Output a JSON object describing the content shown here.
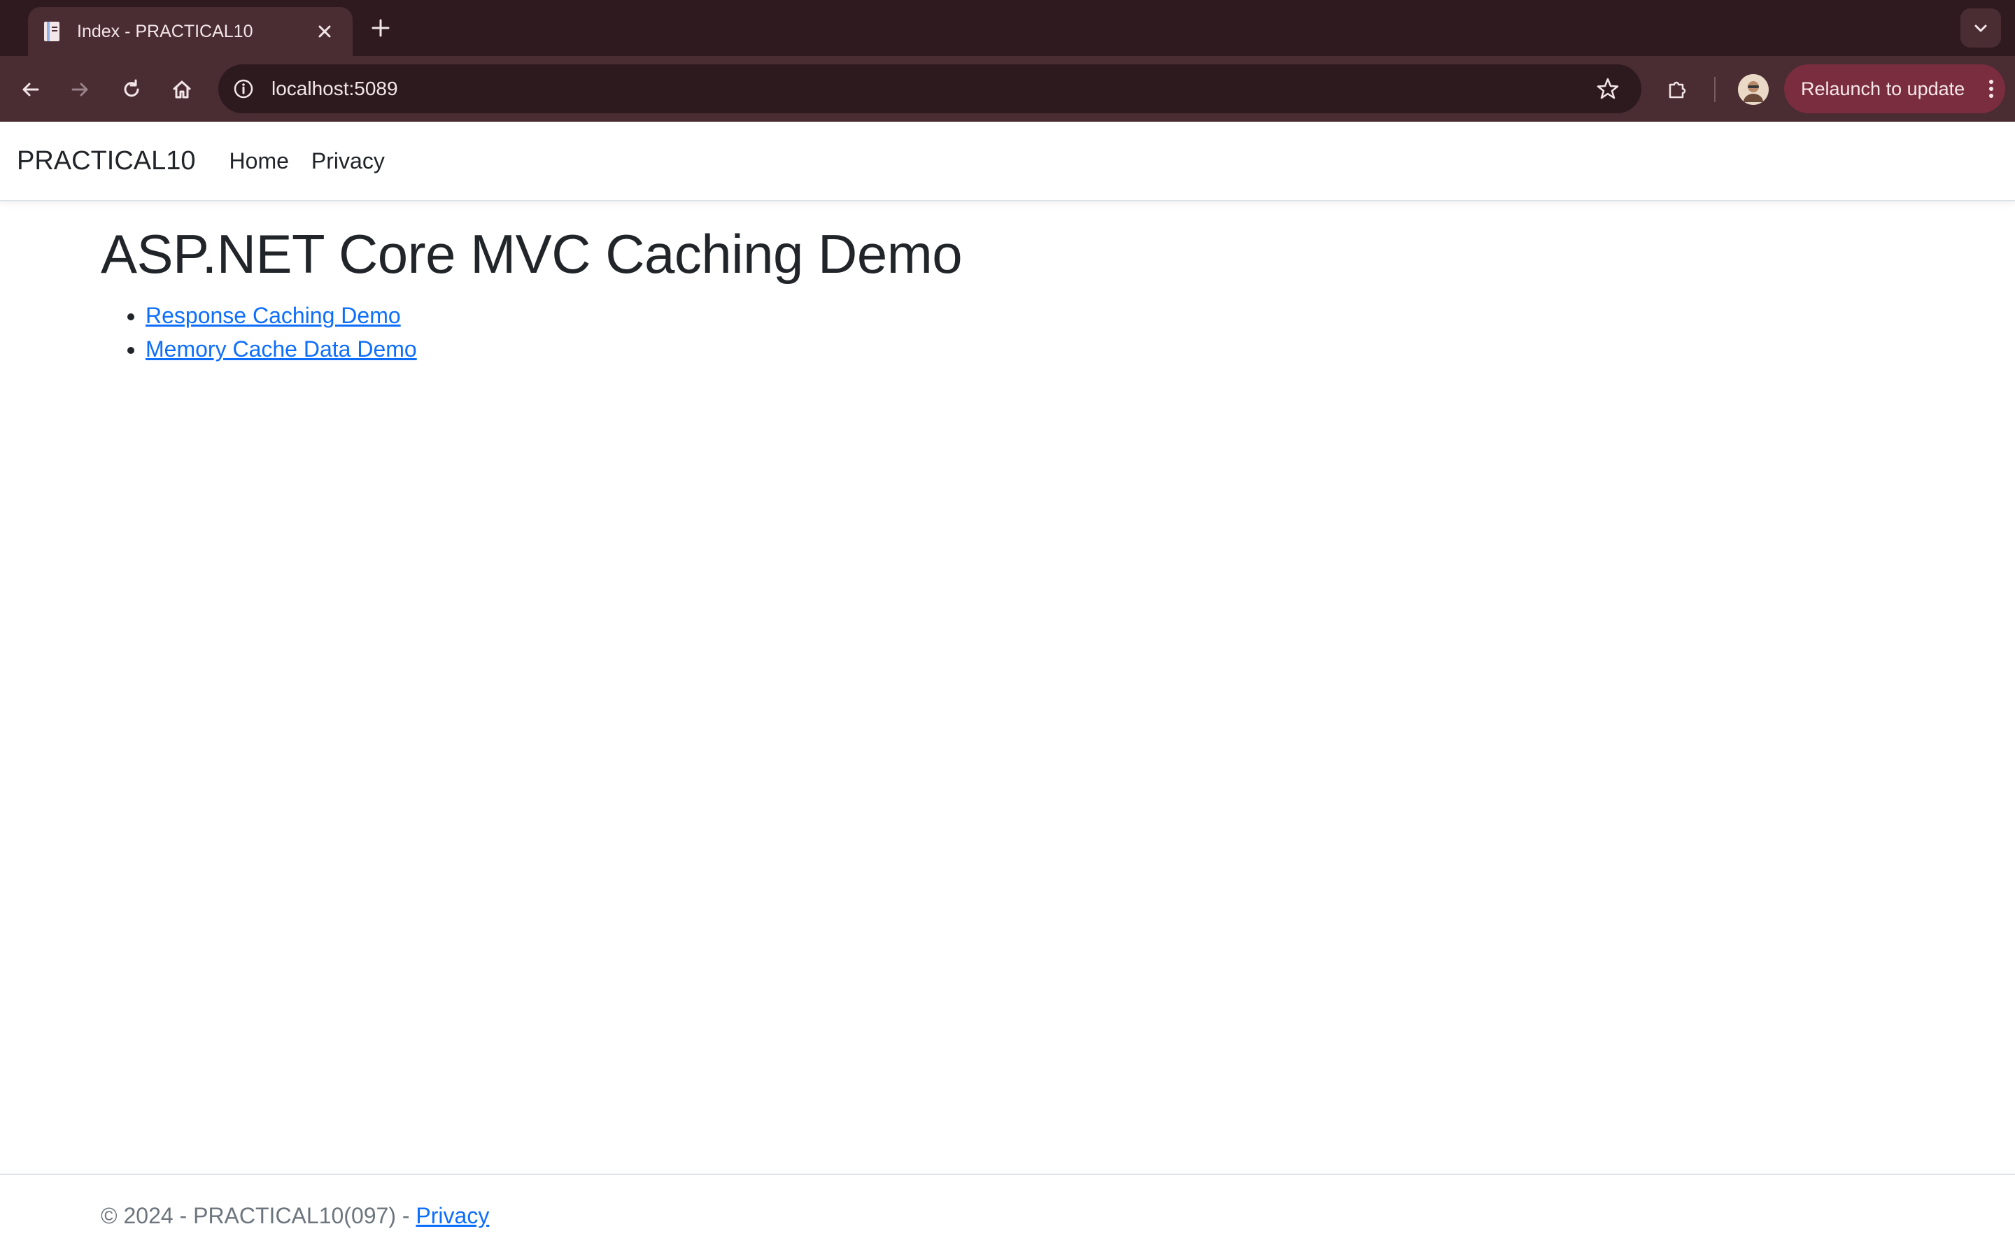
{
  "browser": {
    "tab": {
      "title": "Index - PRACTICAL10",
      "favicon": "page-icon"
    },
    "address": "localhost:5089",
    "relaunch_label": "Relaunch to update",
    "colors": {
      "tabstrip": "#2f1a20",
      "toolbar": "#4a2c33",
      "relaunch": "#7a2d3e"
    }
  },
  "navbar": {
    "brand": "PRACTICAL10",
    "links": [
      "Home",
      "Privacy"
    ]
  },
  "main": {
    "heading": "ASP.NET Core MVC Caching Demo",
    "links": [
      "Response Caching Demo",
      "Memory Cache Data Demo"
    ]
  },
  "footer": {
    "text": "© 2024 - PRACTICAL10(097) - ",
    "privacy_link": "Privacy"
  },
  "colors": {
    "link": "#0d6efd",
    "text": "#212529",
    "muted": "#6c757d"
  }
}
